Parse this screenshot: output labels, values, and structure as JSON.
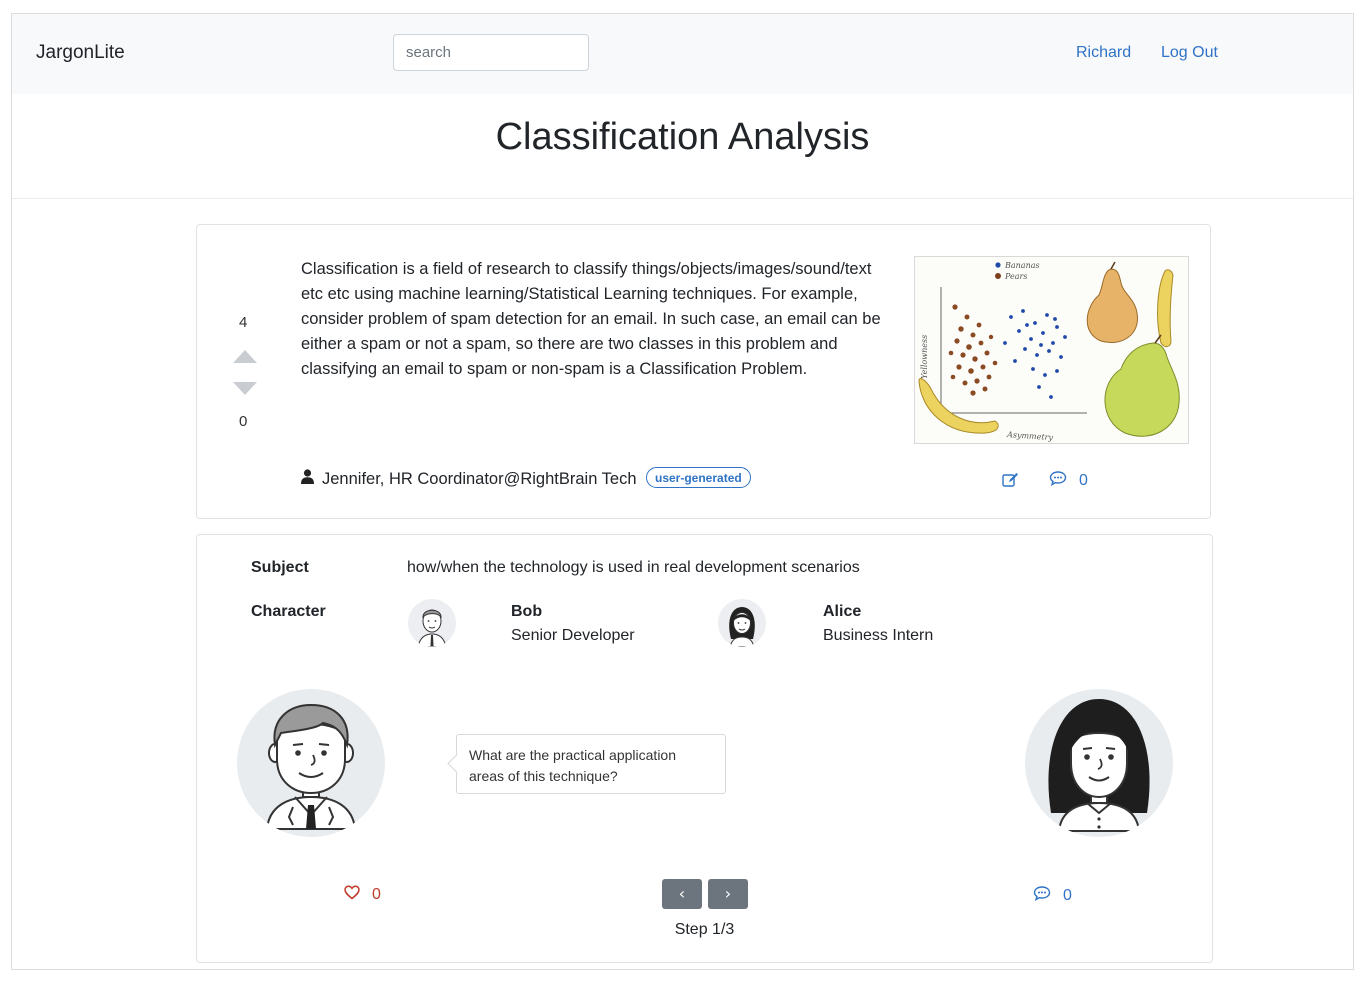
{
  "navbar": {
    "brand": "JargonLite",
    "search_placeholder": "search",
    "user_link": "Richard",
    "logout_link": "Log Out"
  },
  "page": {
    "title": "Classification Analysis"
  },
  "definition": {
    "upvotes": "4",
    "downvotes": "0",
    "text": "Classification is a field of research to classify things/objects/images/sound/text etc etc using machine learning/Statistical Learning techniques. For example, consider problem of spam detection for an email. In such case, an email can be either a spam or not a spam, so there are two classes in this problem and classifying an email to spam or non-spam is a Classification Problem.",
    "author": "Jennifer, HR Coordinator@RightBrain Tech",
    "badge": "user-generated",
    "comment_count": "0",
    "figure": {
      "legend_bananas": "Bananas",
      "legend_pears": "Pears",
      "ylabel": "Yellowness",
      "xlabel": "Asymmetry"
    }
  },
  "scenario": {
    "subject_label": "Subject",
    "subject_text": "how/when the technology is used in real development scenarios",
    "character_label": "Character",
    "characters": [
      {
        "name": "Bob",
        "role": "Senior Developer"
      },
      {
        "name": "Alice",
        "role": "Business Intern"
      }
    ],
    "dialogue": "What are the practical application areas of this technique?",
    "like_count": "0",
    "comment_count": "0",
    "prev_icon": "‹",
    "next_icon": "›",
    "step": "Step 1/3"
  },
  "colors": {
    "link": "#2f73c6",
    "like": "#c0392b",
    "step_button": "#6c757d"
  },
  "icons": [
    "user-icon",
    "edit-icon",
    "comment-icon",
    "heart-icon",
    "chevron-left-icon",
    "chevron-right-icon",
    "caret-up-icon",
    "caret-down-icon"
  ]
}
